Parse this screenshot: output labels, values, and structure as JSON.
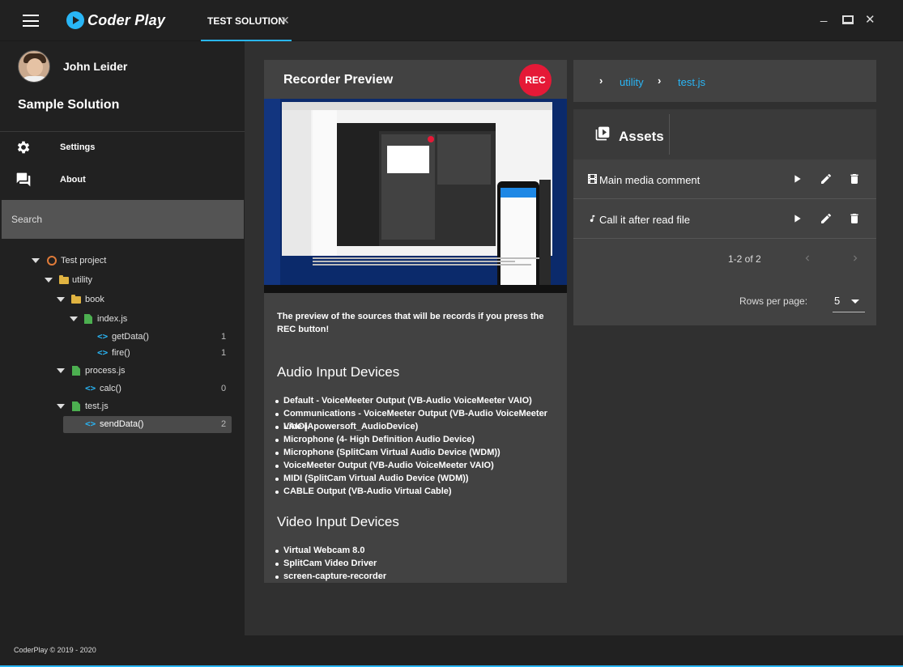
{
  "app": {
    "name": "Coder Play"
  },
  "tabs": [
    {
      "label": "TEST SOLUTION",
      "close": "✕"
    }
  ],
  "window_controls": {
    "minimize": "_",
    "maximize": "□",
    "close": "✕"
  },
  "sidebar": {
    "user_name": "John Leider",
    "solution_name": "Sample Solution",
    "nav": [
      {
        "label": "Settings",
        "icon": "gear-icon"
      },
      {
        "label": "About",
        "icon": "forum-icon"
      }
    ],
    "search_placeholder": "Search",
    "tree": [
      {
        "label": "Test project",
        "type": "project",
        "count": ""
      },
      {
        "label": "utility",
        "type": "folder",
        "count": ""
      },
      {
        "label": "book",
        "type": "folder",
        "count": ""
      },
      {
        "label": "index.js",
        "type": "file",
        "count": ""
      },
      {
        "label": "getData()",
        "type": "function",
        "count": "1"
      },
      {
        "label": "fire()",
        "type": "function",
        "count": "1"
      },
      {
        "label": "process.js",
        "type": "file",
        "count": ""
      },
      {
        "label": "calc()",
        "type": "function",
        "count": "0"
      },
      {
        "label": "test.js",
        "type": "file",
        "count": ""
      },
      {
        "label": "sendData()",
        "type": "function",
        "count": "2"
      }
    ]
  },
  "recorder": {
    "title": "Recorder Preview",
    "rec_label": "REC",
    "description": "The preview of the sources that will be records if you press the REC button!",
    "audio_title": "Audio Input Devices",
    "audio_devices": [
      "Default - VoiceMeeter Output (VB-Audio VoiceMeeter VAIO)",
      "Communications - VoiceMeeter Output (VB-Audio VoiceMeeter VAIO)",
      "Line (Apowersoft_AudioDevice)",
      "Microphone (4- High Definition Audio Device)",
      "Microphone (SplitCam Virtual Audio Device (WDM))",
      "VoiceMeeter Output (VB-Audio VoiceMeeter VAIO)",
      "MIDI (SplitCam Virtual Audio Device (WDM))",
      "CABLE Output (VB-Audio Virtual Cable)"
    ],
    "video_title": "Video Input Devices",
    "video_devices": [
      "Virtual Webcam 8.0",
      "SplitCam Video Driver",
      "screen-capture-recorder"
    ]
  },
  "breadcrumb": [
    "utility",
    "test.js"
  ],
  "assets": {
    "title": "Assets",
    "items": [
      {
        "label": "Main media comment",
        "icon": "film-icon"
      },
      {
        "label": "Call it after read file",
        "icon": "music-note-icon"
      }
    ],
    "pagination": "1-2 of 2",
    "rows_per_page_label": "Rows per page:",
    "rows_per_page_value": "5"
  },
  "footer": {
    "text": "CoderPlay © 2019 - 2020"
  },
  "colors": {
    "accent": "#29b6f6",
    "rec": "#e51937",
    "background": "#303030",
    "panel": "#424242",
    "sidebar": "#212121"
  }
}
